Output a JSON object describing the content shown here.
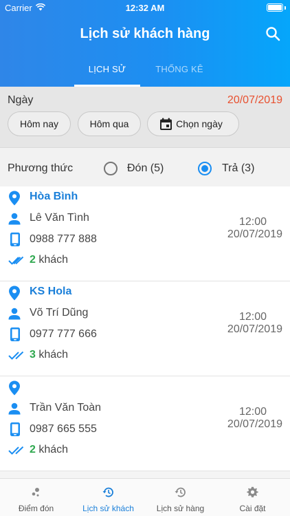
{
  "status_bar": {
    "carrier": "Carrier",
    "time": "12:32 AM"
  },
  "header": {
    "title": "Lịch sử khách hàng"
  },
  "tabs": [
    {
      "label": "LỊCH SỬ"
    },
    {
      "label": "THỐNG KÊ"
    }
  ],
  "date_filter": {
    "label": "Ngày",
    "selected_date": "20/07/2019",
    "buttons": {
      "today": "Hôm nay",
      "yesterday": "Hôm qua",
      "pick": "Chọn ngày"
    }
  },
  "method_filter": {
    "label": "Phương thức",
    "options": [
      {
        "label": "Đón (5)",
        "selected": false
      },
      {
        "label": "Trả (3)",
        "selected": true
      }
    ]
  },
  "records": [
    {
      "location": "Hòa Bình",
      "name": "Lê Văn Tình",
      "phone": "0988 777 888",
      "guest_count": "2",
      "guest_suffix": " khách",
      "time": "12:00",
      "date": "20/07/2019"
    },
    {
      "location": "KS Hola",
      "name": "Võ Trí Dũng",
      "phone": "0977 777 666",
      "guest_count": "3",
      "guest_suffix": " khách",
      "time": "12:00",
      "date": "20/07/2019"
    },
    {
      "location": "",
      "name": "Trần Văn Toàn",
      "phone": "0987 665 555",
      "guest_count": "2",
      "guest_suffix": " khách",
      "time": "12:00",
      "date": "20/07/2019"
    }
  ],
  "bottom_nav": [
    {
      "label": "Điểm đón",
      "active": false
    },
    {
      "label": "Lịch sử khách",
      "active": true
    },
    {
      "label": "Lịch sử hàng",
      "active": false
    },
    {
      "label": "Cài đặt",
      "active": false
    }
  ],
  "colors": {
    "primary": "#1a8ef2",
    "accent_date": "#e8502f",
    "guest_count": "#2fa84f",
    "location_text": "#1a7fd9"
  }
}
